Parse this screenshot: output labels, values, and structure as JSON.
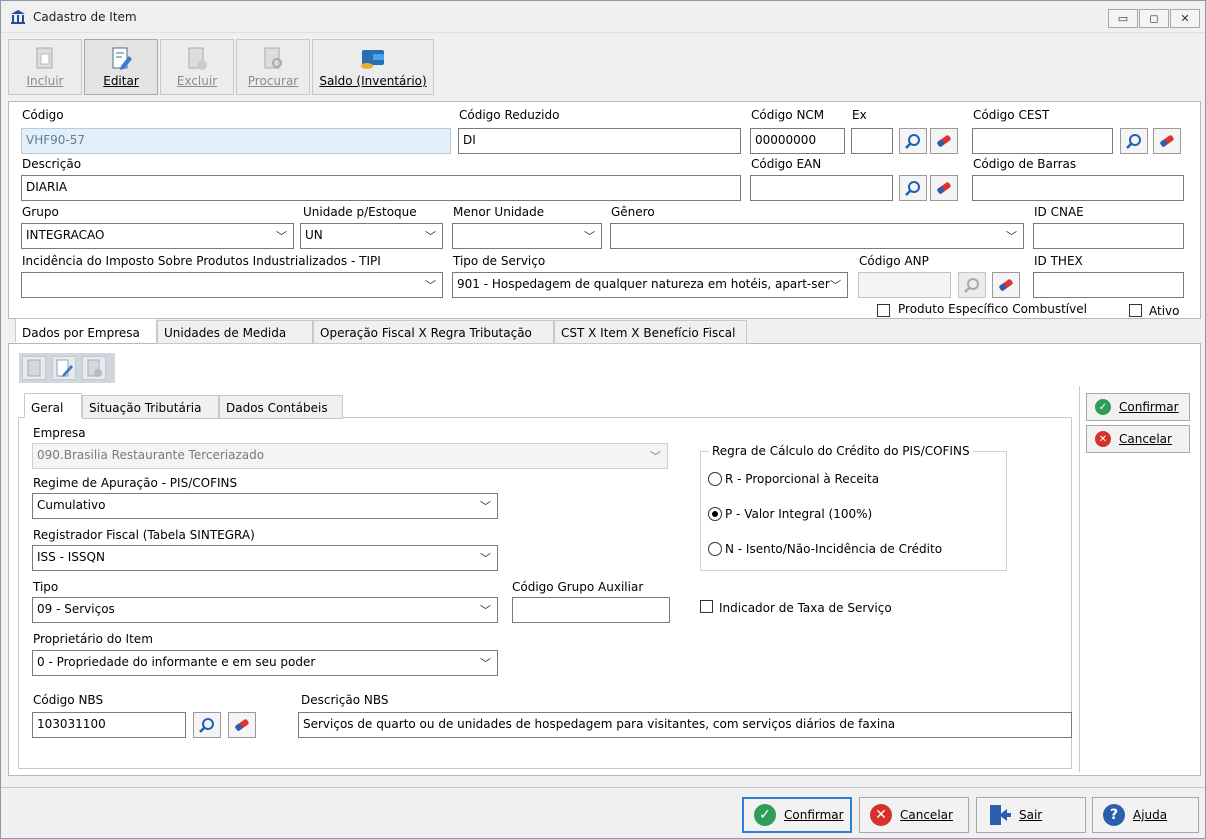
{
  "window": {
    "title": "Cadastro de Item"
  },
  "toolbar": {
    "incluir": "Incluir",
    "editar": "Editar",
    "excluir": "Excluir",
    "procurar": "Procurar",
    "saldo": "Saldo (Inventário)"
  },
  "form": {
    "codigo_label": "Código",
    "codigo_value": "VHF90-57",
    "codigo_reduzido_label": "Código Reduzido",
    "codigo_reduzido_value": "DI",
    "codigo_ncm_label": "Código NCM",
    "codigo_ncm_value": "00000000",
    "ex_label": "Ex",
    "ex_value": "",
    "codigo_cest_label": "Código CEST",
    "codigo_cest_value": "",
    "descricao_label": "Descrição",
    "descricao_value": "DIARIA",
    "codigo_ean_label": "Código EAN",
    "codigo_ean_value": "",
    "codigo_barras_label": "Código de Barras",
    "codigo_barras_value": "",
    "grupo_label": "Grupo",
    "grupo_value": "INTEGRACAO",
    "unidade_estoque_label": "Unidade p/Estoque",
    "unidade_estoque_value": "UN",
    "menor_unidade_label": "Menor Unidade",
    "menor_unidade_value": "",
    "genero_label": "Gênero",
    "genero_value": "",
    "id_cnae_label": "ID CNAE",
    "id_cnae_value": "",
    "tipi_label": "Incidência do Imposto Sobre Produtos Industrializados - TIPI",
    "tipi_value": "",
    "tipo_servico_label": "Tipo de Serviço",
    "tipo_servico_value": "901 - Hospedagem de qualquer natureza em hotéis, apart-serv",
    "codigo_anp_label": "Código ANP",
    "codigo_anp_value": "",
    "id_thex_label": "ID THEX",
    "id_thex_value": "",
    "produto_combustivel_label": "Produto Específico Combustível",
    "ativo_label": "Ativo"
  },
  "tabs": [
    "Dados por Empresa",
    "Unidades de Medida",
    "Operação Fiscal X Regra Tributação",
    "CST X Item X Benefício Fiscal"
  ],
  "subtabs": [
    "Geral",
    "Situação Tributária",
    "Dados Contábeis"
  ],
  "geral": {
    "empresa_label": "Empresa",
    "empresa_value": "090.Brasilia Restaurante Terceriazado",
    "regime_label": "Regime de Apuração - PIS/COFINS",
    "regime_value": "Cumulativo",
    "registrador_label": "Registrador Fiscal (Tabela SINTEGRA)",
    "registrador_value": "ISS - ISSQN",
    "tipo_label": "Tipo",
    "tipo_value": "09 - Serviços",
    "codigo_grupo_aux_label": "Código Grupo Auxiliar",
    "codigo_grupo_aux_value": "",
    "proprietario_label": "Proprietário do Item",
    "proprietario_value": "0 - Propriedade do informante e em seu poder",
    "codigo_nbs_label": "Código NBS",
    "codigo_nbs_value": "103031100",
    "descricao_nbs_label": "Descrição NBS",
    "descricao_nbs_value": "Serviços de quarto ou de unidades de hospedagem para visitantes, com serviços diários de faxina",
    "regra_credito_label": "Regra de Cálculo do Crédito do PIS/COFINS",
    "radio_r": "R - Proporcional à Receita",
    "radio_p": "P - Valor Integral (100%)",
    "radio_n": "N - Isento/Não-Incidência de Crédito",
    "indicador_taxa_label": "Indicador de Taxa de Serviço"
  },
  "side": {
    "confirmar": "Confirmar",
    "cancelar": "Cancelar"
  },
  "footer": {
    "confirmar": "Confirmar",
    "cancelar": "Cancelar",
    "sair": "Sair",
    "ajuda": "Ajuda"
  },
  "colors": {
    "accent_blue": "#2f7fd6",
    "green": "#2e9e57",
    "red": "#d6322b",
    "readonly_bg": "#e2eef8"
  }
}
